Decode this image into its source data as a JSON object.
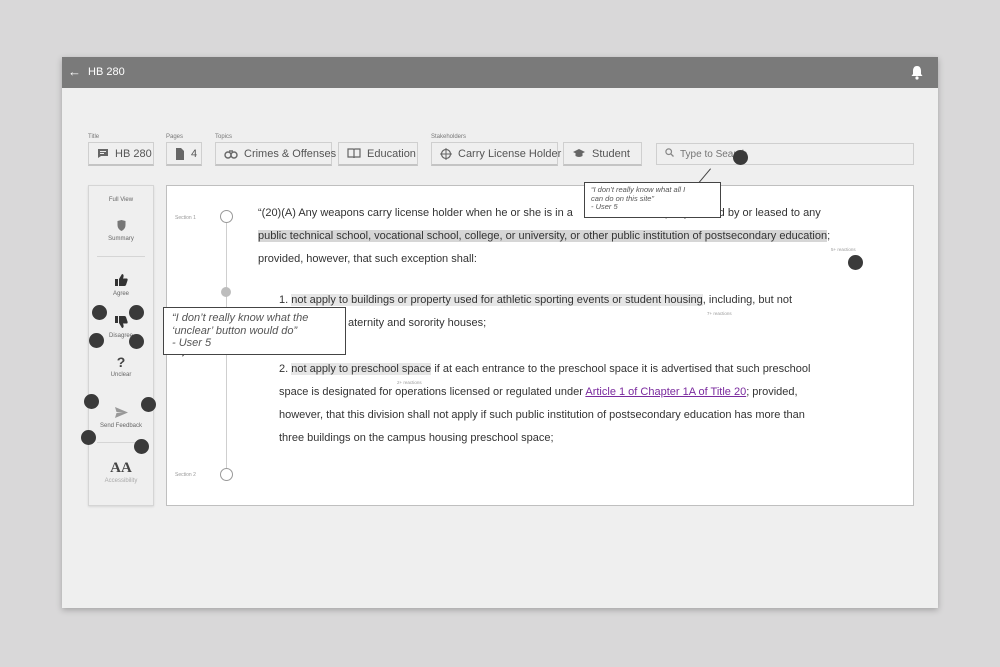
{
  "topbar": {
    "back_icon": "back-arrow-icon",
    "title": "HB 280",
    "bell_icon": "bell-icon"
  },
  "fields": {
    "title_label": "Title",
    "pages_label": "Pages",
    "topics_label": "Topics",
    "stakeholders_label": "Stakeholders",
    "title_value": "HB 280",
    "pages_value": "4",
    "topics": [
      "Crimes & Offenses",
      "Education"
    ],
    "stakeholders": [
      "Carry License Holder",
      "Student"
    ],
    "search_placeholder": "Type to Search"
  },
  "sidebar": {
    "full_view": "Full View",
    "summary": "Summary",
    "agree": "Agree",
    "disagree": "Disagree",
    "unclear": "Unclear",
    "send_feedback": "Send Feedback",
    "accessibility": "Accessibility",
    "accessibility_glyph": "AA",
    "unclear_glyph": "?"
  },
  "document": {
    "section1": "Section 1",
    "section2": "Section 2",
    "para1_line1_a": "“(20)(A) Any weapons carry license holder when he or she is in a",
    "para1_line1_b": "perty owned by or leased to any",
    "para1_line2": "public technical school, vocational school, college, or university, or other public institution of postsecondary education",
    "para1_line2_end": ";",
    "para1_line3": "provided, however, that such exception shall:",
    "reactions_a": "5+ reactions",
    "item1_line1_a": "1. ",
    "item1_line1_b": "not apply to buildings or property used for athletic sporting events or student  housing",
    "item1_line1_c": ", including, but not",
    "item1_line2": "aternity and sorority houses;",
    "reactions_b": "7+ reactions",
    "item2_line1_a": "2. ",
    "item2_line1_b": "not apply to preschool space",
    "item2_line1_c": " if at each entrance to the preschool space it is advertised that such preschool",
    "reactions_c": "2+ reactions",
    "item2_line2_a": "space is designated for operations licensed or regulated under ",
    "item2_line2_link": "Article 1 of Chapter 1A of Title 20",
    "item2_line2_c": "; provided,",
    "item2_line3": "however, that this division shall not apply if such public institution of postsecondary education has more than",
    "item2_line4": "three buildings on the campus housing preschool space;"
  },
  "annotations": {
    "quote1_line1": "“I don’t really know what all I",
    "quote1_line2": "can do on this site”",
    "quote1_line3": "- User 5",
    "quote2_line1": "“I don’t really know what the",
    "quote2_line2": "‘unclear’ button would do”",
    "quote2_line3": "- User 5"
  }
}
